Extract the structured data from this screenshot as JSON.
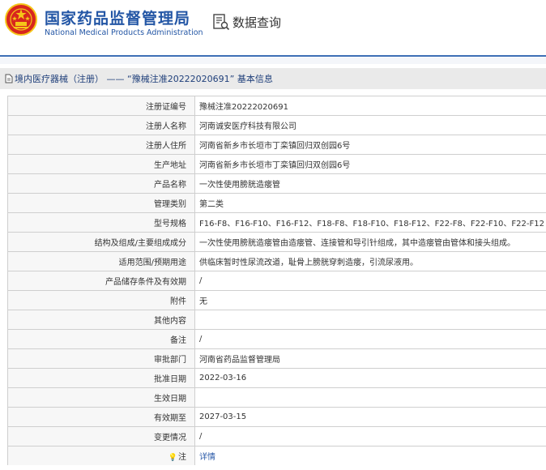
{
  "header": {
    "site_name_cn": "国家药品监督管理局",
    "site_name_en": "National Medical Products Administration",
    "query_title": "数据查询",
    "emblem_icon": "national-emblem-icon",
    "query_icon": "document-search-icon"
  },
  "title_bar": {
    "text": "境内医疗器械（注册） —— “豫械注准20222020691” 基本信息",
    "icon": "document-icon"
  },
  "fields": [
    {
      "label": "注册证编号",
      "value": "豫械注准20222020691"
    },
    {
      "label": "注册人名称",
      "value": "河南诚安医疗科技有限公司"
    },
    {
      "label": "注册人住所",
      "value": "河南省新乡市长垣市丁栾镇回归双创园6号"
    },
    {
      "label": "生产地址",
      "value": "河南省新乡市长垣市丁栾镇回归双创园6号"
    },
    {
      "label": "产品名称",
      "value": "一次性使用膀胱造瘘管"
    },
    {
      "label": "管理类别",
      "value": "第二类"
    },
    {
      "label": "型号规格",
      "value": "F16-F8、F16-F10、F16-F12、F18-F8、F18-F10、F18-F12、F22-F8、F22-F10、F22-F12"
    },
    {
      "label": "结构及组成/主要组成成分",
      "value": "一次性使用膀胱造瘘管由造瘘管、连接管和导引针组成，其中造瘘管由管体和接头组成。"
    },
    {
      "label": "适用范围/预期用途",
      "value": "供临床暂时性尿流改道，耻骨上膀胱穿刺造瘘，引流尿液用。"
    },
    {
      "label": "产品储存条件及有效期",
      "value": "/"
    },
    {
      "label": "附件",
      "value": "无"
    },
    {
      "label": "其他内容",
      "value": ""
    },
    {
      "label": "备注",
      "value": "/"
    },
    {
      "label": "审批部门",
      "value": "河南省药品监督管理局"
    },
    {
      "label": "批准日期",
      "value": "2022-03-16"
    },
    {
      "label": "生效日期",
      "value": ""
    },
    {
      "label": "有效期至",
      "value": "2027-03-15"
    },
    {
      "label": "变更情况",
      "value": "/"
    }
  ],
  "note_row": {
    "label": "注",
    "icon": "lightbulb-icon",
    "link_text": "详情"
  },
  "colors": {
    "brand_blue": "#2356a5",
    "emblem_red": "#d7261e",
    "emblem_gold": "#f5c518",
    "link_blue": "#2a5aa8"
  }
}
